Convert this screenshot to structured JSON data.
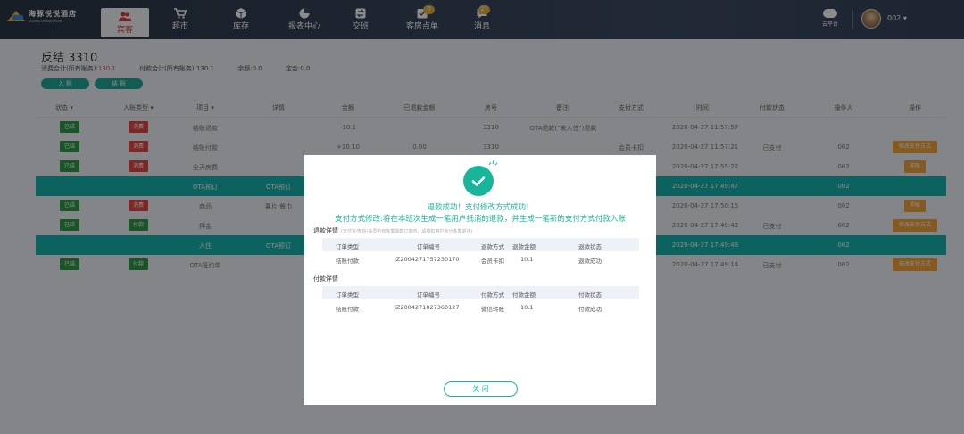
{
  "app": {
    "name": "海豚悦悦酒店",
    "subtitle": "DOLPHIN VERNIOS HOTEL"
  },
  "nav": {
    "items": [
      {
        "label": "宾客",
        "icon": "guest-icon"
      },
      {
        "label": "超市",
        "icon": "cart-icon"
      },
      {
        "label": "库存",
        "icon": "box-icon"
      },
      {
        "label": "报表中心",
        "icon": "pie-chart-icon"
      },
      {
        "label": "交班",
        "icon": "handover-icon"
      },
      {
        "label": "客房点单",
        "icon": "order-icon",
        "badge": "0"
      },
      {
        "label": "消息",
        "icon": "message-icon",
        "badge": "27"
      }
    ],
    "cloud_label": "云平台",
    "user_name": "002"
  },
  "page": {
    "title": "反结 3310",
    "summary": {
      "consume_label": "消费合计(所有账务):",
      "consume_value": "130.1",
      "pay_label": "付款合计(所有账务):",
      "pay_value": "130.1",
      "balance_label": "余额:",
      "balance_value": "0.0",
      "deposit_label": "定金:",
      "deposit_value": "0.0"
    },
    "buttons": [
      "入 账",
      "结 账"
    ]
  },
  "table": {
    "headers": [
      "状态",
      "入账类型",
      "项目",
      "详情",
      "金额",
      "已退款金额",
      "房号",
      "备注",
      "支付方式",
      "时间",
      "付款状态",
      "操作人",
      "操作"
    ],
    "rows": [
      {
        "tag1": "已结",
        "tag2": "消费",
        "item": "结账退款",
        "detail": "",
        "amount": "-10.1",
        "refunded": "",
        "room": "3310",
        "note": "OTA退款(\"未入住\")退款",
        "paymethod": "",
        "time": "2020-04-27 11:57:57",
        "paystatus": "",
        "operator": "",
        "action": ""
      },
      {
        "tag1": "已结",
        "tag2": "消费",
        "item": "结账付款",
        "detail": "",
        "amount": "+10.10",
        "refunded": "0.00",
        "room": "3310",
        "note": "",
        "paymethod": "会员卡扣",
        "time": "2020-04-27 11:57:21",
        "paystatus": "已支付",
        "operator": "002",
        "action": "修改支付方式"
      },
      {
        "tag1": "已结",
        "tag2": "消费",
        "item": "全天房费",
        "detail": "",
        "amount": "",
        "refunded": "",
        "room": "",
        "note": "",
        "paymethod": "",
        "time": "2020-04-27 17:55:22",
        "paystatus": "",
        "operator": "002",
        "action": "冲账"
      },
      {
        "hl": true,
        "item": "OTA预订",
        "detail": "OTA预订",
        "time": "2020-04-27 17:49:47",
        "operator": "002"
      },
      {
        "tag1": "已结",
        "tag2": "消费",
        "item": "商品",
        "detail": "薯片 餐巾",
        "amount": "",
        "refunded": "",
        "room": "",
        "note": "",
        "paymethod": "",
        "time": "2020-04-27 17:50:15",
        "paystatus": "",
        "operator": "002",
        "action": "冲账"
      },
      {
        "tag1": "已结",
        "tag2": "付款",
        "item": "押金",
        "detail": "",
        "amount": "",
        "refunded": "",
        "room": "",
        "note": "",
        "paymethod": "",
        "time": "2020-04-27 17:49:49",
        "paystatus": "已支付",
        "operator": "002",
        "action": "修改支付方式"
      },
      {
        "hl": true,
        "item": "入住",
        "detail": "OTA预订",
        "time": "2020-04-27 17:49:48",
        "operator": "002"
      },
      {
        "tag1": "已结",
        "tag2": "付款",
        "item": "OTA签约单",
        "detail": "",
        "amount": "",
        "refunded": "",
        "room": "",
        "note": "",
        "paymethod": "",
        "time": "2020-04-27 17:49:14",
        "paystatus": "已支付",
        "operator": "002",
        "action": "修改支付方式"
      }
    ]
  },
  "modal": {
    "success_line1": "退款成功！支付修改方式成功！",
    "success_line2": "支付方式修改:将在本班次生成一笔用户抵消的退款，并生成一笔新的支付方式付款入账",
    "refund_section": "退款详情",
    "refund_hint": "(支付宝/微信/会员卡有多笔退款订单时，请按扣用户余分多笔退还)",
    "refund_headers": [
      "订单类型",
      "订单编号",
      "退款方式",
      "退款金额",
      "退款状态"
    ],
    "refund_rows": [
      [
        "结账付款",
        "JZ2004271757230170",
        "会员卡扣",
        "10.1",
        "退款成功"
      ]
    ],
    "pay_section": "付款详情",
    "pay_headers": [
      "订单类型",
      "订单编号",
      "付款方式",
      "付款金额",
      "付款状态"
    ],
    "pay_rows": [
      [
        "结账付款",
        "JZ2004271827360127",
        "微信转账",
        "10.1",
        "付款成功"
      ]
    ],
    "close_label": "关 闭",
    "colors": {
      "accent": "#19b59b"
    }
  }
}
